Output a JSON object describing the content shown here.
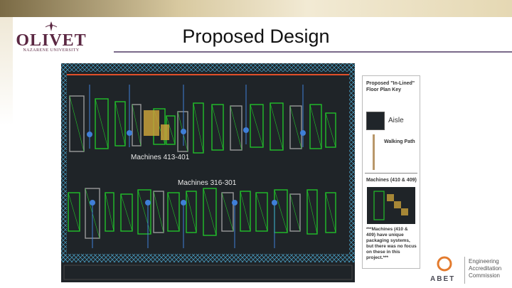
{
  "header": {
    "title": "Proposed Design",
    "logo_name": "OLIVET",
    "logo_subtitle": "NAZARENE UNIVERSITY"
  },
  "floor_plan": {
    "label_upper_row": "Machines 413-401",
    "label_lower_row": "Machines 316-301"
  },
  "key": {
    "title": "Proposed \"In-Lined\" Floor Plan Key",
    "aisle_label": "Aisle",
    "walking_path_label": "Walking Path",
    "machines_label": "Machines (410 & 409)",
    "note": "***Machines (410 & 409) have unique packaging systems, but there was no focus on these in this project.***"
  },
  "footer": {
    "org_name": "ABET",
    "org_full": "Engineering Accreditation Commission"
  },
  "colors": {
    "accent": "#5b2742",
    "plan_bg": "#1f2428",
    "machine_green": "#22c02a",
    "walk_blue": "#3f7fd8",
    "abet_orange": "#e37b2e"
  }
}
